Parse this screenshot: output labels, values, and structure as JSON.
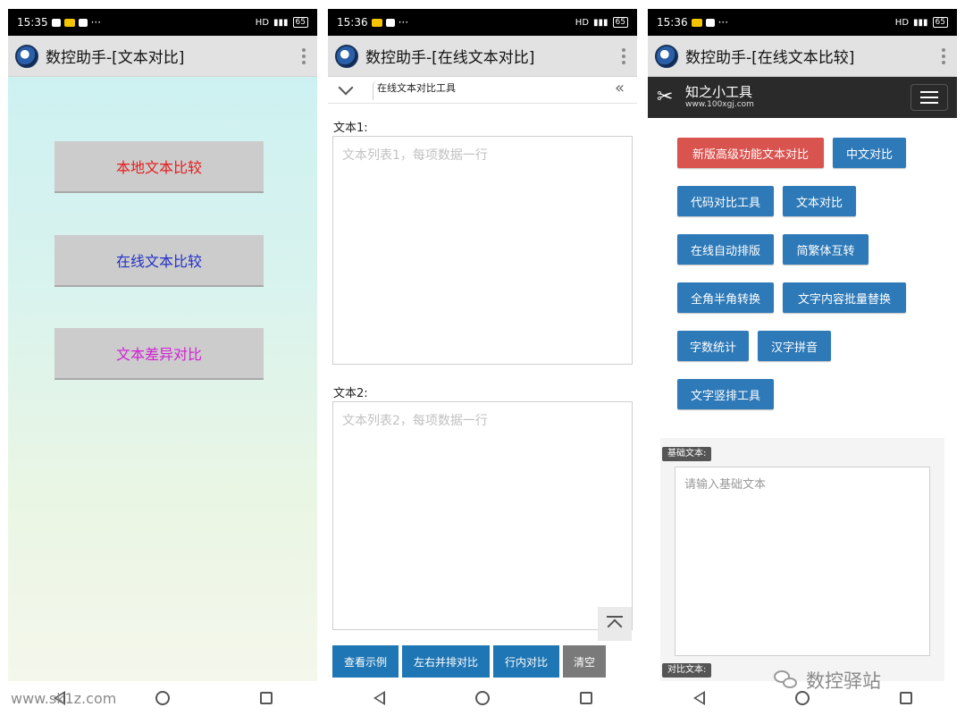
{
  "status": {
    "p1_time": "15:35",
    "p2_time": "15:36",
    "p3_time": "15:36",
    "more": "···",
    "network": "HD",
    "battery": "65"
  },
  "app": {
    "p1_title": "数控助手-[文本对比]",
    "p2_title": "数控助手-[在线文本对比]",
    "p3_title": "数控助手-[在线文本比较]"
  },
  "screen1": {
    "buttons": [
      "本地文本比较",
      "在线文本比较",
      "文本差异对比"
    ],
    "colors": {
      "local": "#e51d1d",
      "online": "#2230c6",
      "diff": "#d21fd4"
    }
  },
  "screen2": {
    "tab_label": "在线文本对比工具",
    "text1_label": "文本1:",
    "text1_placeholder": "文本列表1，每项数据一行",
    "text2_label": "文本2:",
    "text2_placeholder": "文本列表2，每项数据一行",
    "actions": [
      "查看示例",
      "左右并排对比",
      "行内对比",
      "清空"
    ]
  },
  "screen3": {
    "site_name": "知之小工具",
    "site_url": "www.100xgj.com",
    "tools": [
      "新版高级功能文本对比",
      "中文对比",
      "代码对比工具",
      "文本对比",
      "在线自动排版",
      "简繁体互转",
      "全角半角转换",
      "文字内容批量替换",
      "字数统计",
      "汉字拼音",
      "文字竖排工具"
    ],
    "base_tag": "基础文本:",
    "base_placeholder": "请输入基础文本",
    "compare_tag": "对比文本:"
  },
  "watermarks": {
    "left": "www.sk1z.com",
    "wechat": "数控驿站"
  }
}
